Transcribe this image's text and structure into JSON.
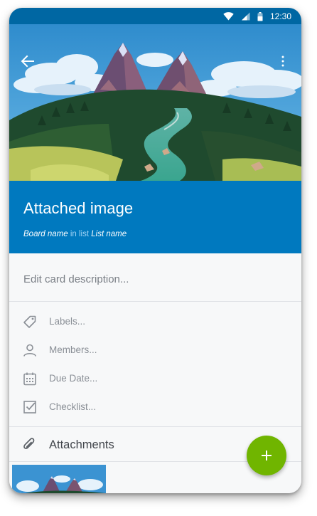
{
  "status_bar": {
    "time": "12:30",
    "icons": [
      "wifi-icon",
      "signal-icon",
      "battery-icon"
    ]
  },
  "toolbar": {
    "back_icon": "arrow-left-icon",
    "menu_icon": "more-vertical-icon"
  },
  "card": {
    "title": "Attached image",
    "board_name": "Board name",
    "in_list": "in list",
    "list_name": "List name"
  },
  "description": {
    "placeholder": "Edit card description..."
  },
  "options": [
    {
      "label": "Labels...",
      "icon": "tag-icon"
    },
    {
      "label": "Members...",
      "icon": "person-icon"
    },
    {
      "label": "Due Date...",
      "icon": "calendar-icon"
    },
    {
      "label": "Checklist...",
      "icon": "checkbox-icon"
    }
  ],
  "attachments": {
    "label": "Attachments",
    "icon": "paperclip-icon"
  },
  "fab": {
    "icon": "plus-icon"
  },
  "colors": {
    "status_bar": "#0067a3",
    "header": "#0079bf",
    "fab": "#70b500",
    "background": "#f7f8f9"
  }
}
